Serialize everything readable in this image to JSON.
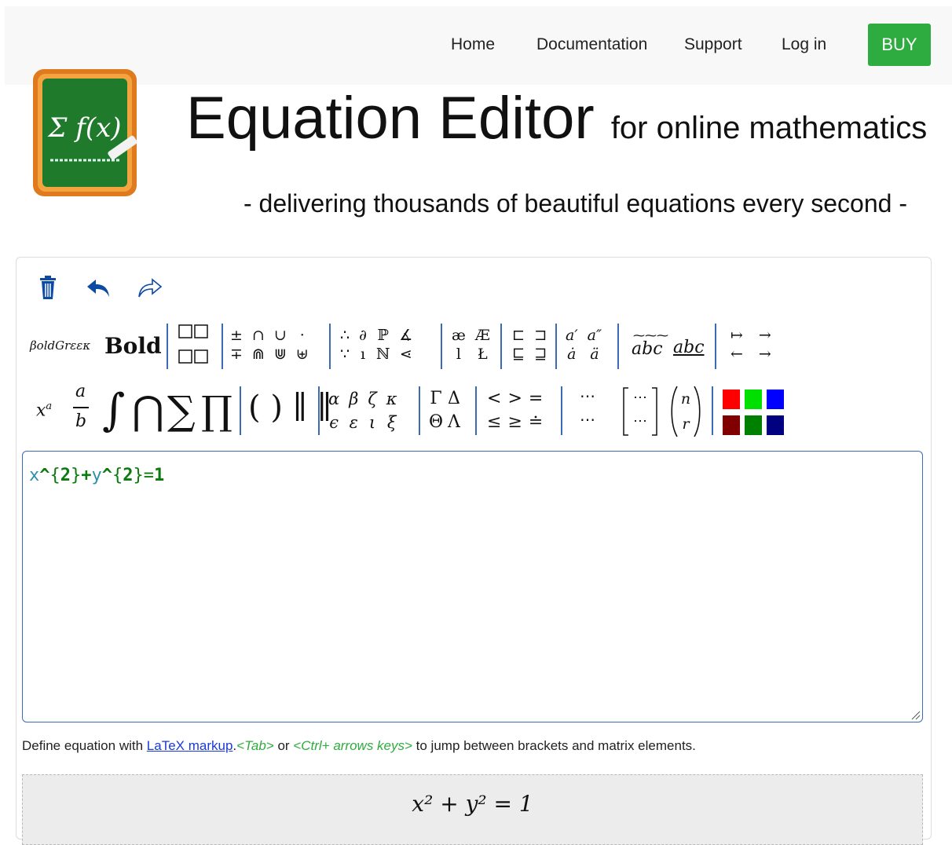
{
  "nav": {
    "home": "Home",
    "documentation": "Documentation",
    "support": "Support",
    "login": "Log in",
    "buy": "BUY"
  },
  "logo_text": "Σ f(x)",
  "header": {
    "title": "Equation Editor",
    "subtitle": "for online mathematics",
    "tagline": "- delivering thousands of beautiful equations every second -"
  },
  "toolbar": {
    "icons": [
      "trash-icon",
      "undo-icon",
      "redo-icon"
    ],
    "row1": {
      "bold_greek": "βoldGrεεκ",
      "bold": "Bold",
      "operators_top": [
        "±",
        "∩",
        "∪",
        "·"
      ],
      "operators_bottom": [
        "∓",
        "⋒",
        "⋓",
        "⊎"
      ],
      "symbols_top": [
        "∴",
        "∂",
        "ℙ",
        "∡"
      ],
      "symbols_bottom": [
        "∵",
        "ı",
        "ℕ",
        "⋖"
      ],
      "letters_top": [
        "æ",
        "Æ"
      ],
      "letters_bottom": [
        "l",
        "Ł"
      ],
      "subset_top": [
        "⊏",
        "⊐"
      ],
      "subset_bottom": [
        "⊑",
        "⊒"
      ],
      "accents_top": [
        "a′",
        "a″"
      ],
      "accents_bottom": [
        "ȧ",
        "ä"
      ],
      "wide_accent": "abc",
      "underline": "abc",
      "arrows_top": [
        "↦",
        "→"
      ],
      "arrows_bottom": [
        "←",
        "→"
      ]
    },
    "row2": {
      "power": "x",
      "power_sup": "a",
      "frac_num": "a",
      "frac_den": "b",
      "big_ops": [
        "∫",
        "⋂",
        "∑",
        "∏"
      ],
      "brackets": "( ) ∥ ∥",
      "greek_top": [
        "α",
        "β",
        "ζ",
        "κ"
      ],
      "greek_bottom": [
        "ϵ",
        "ε",
        "ι",
        "ξ"
      ],
      "greek_cap_top": [
        "Γ",
        "Δ"
      ],
      "greek_cap_bottom": [
        "Θ",
        "Λ"
      ],
      "relations_top": [
        "<",
        ">",
        "="
      ],
      "relations_bottom": [
        "≤",
        "≥",
        "≐"
      ],
      "dots_top": "⋯",
      "dots_bottom": "⋯",
      "matrix": "⋯",
      "binom_top": "n",
      "binom_bottom": "r"
    },
    "colors": [
      "#ff0000",
      "#00e000",
      "#0000ff",
      "#800000",
      "#008000",
      "#000080"
    ]
  },
  "editor": {
    "code": [
      "x",
      "^",
      "{",
      "2",
      "}",
      "+",
      "y",
      "^",
      "{",
      "2",
      "}",
      "=",
      "1"
    ]
  },
  "help": {
    "prefix": "Define equation with ",
    "link": "LaTeX markup",
    "dot": ".",
    "tab_hint": "<Tab>",
    "or": " or ",
    "ctrl_hint": "<Ctrl+ arrows keys>",
    "suffix": " to jump between brackets and matrix elements."
  },
  "preview": {
    "equation": "x² + y² = 1"
  }
}
